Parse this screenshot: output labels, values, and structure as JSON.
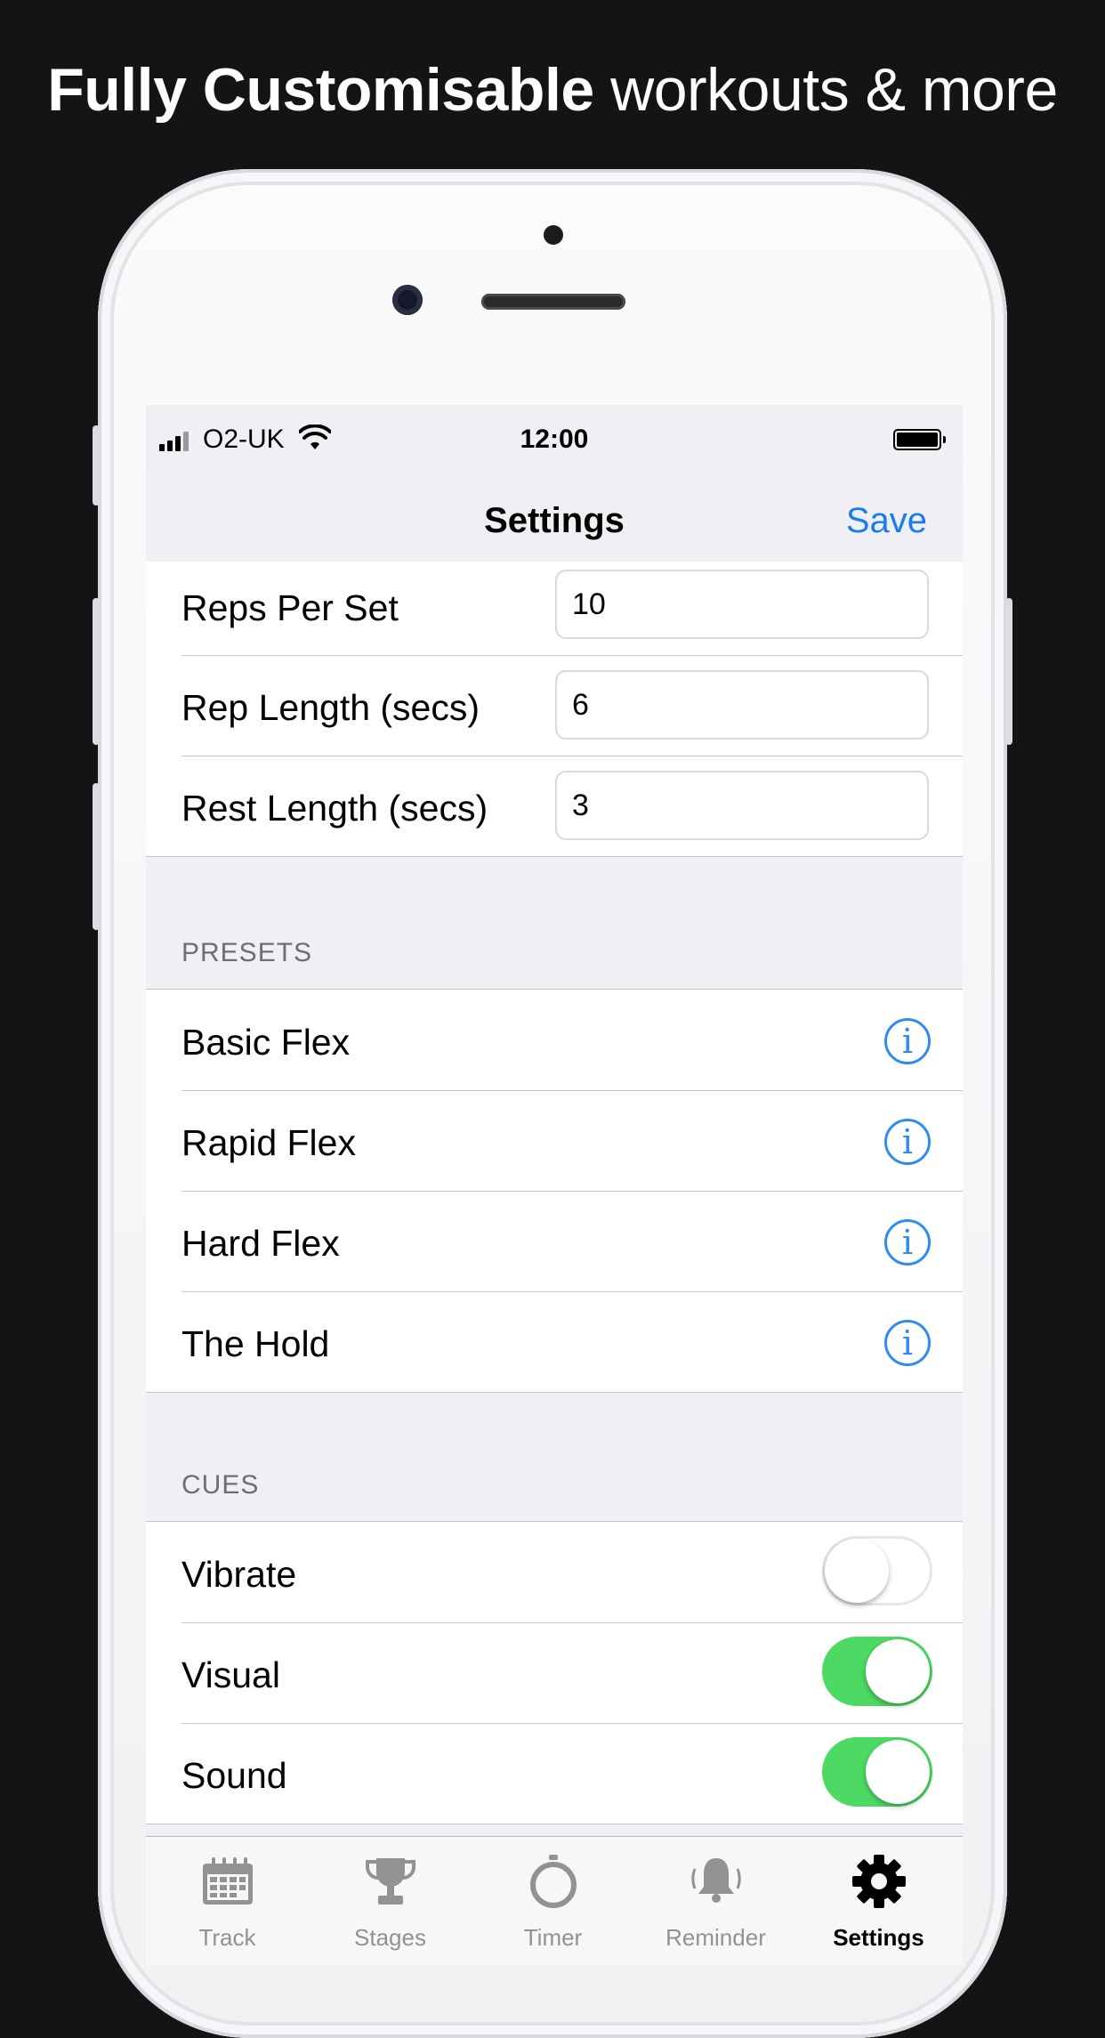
{
  "headline": {
    "bold": "Fully Customisable",
    "light": "workouts & more"
  },
  "status_bar": {
    "carrier": "O2-UK",
    "time": "12:00"
  },
  "nav": {
    "title": "Settings",
    "save": "Save"
  },
  "workout": [
    {
      "label": "Reps Per Set",
      "value": "10"
    },
    {
      "label": "Rep Length (secs)",
      "value": "6"
    },
    {
      "label": "Rest Length (secs)",
      "value": "3"
    }
  ],
  "presets": {
    "header": "PRESETS",
    "items": [
      "Basic Flex",
      "Rapid Flex",
      "Hard Flex",
      "The Hold"
    ],
    "info_icon": "info-icon",
    "info_glyph": "i"
  },
  "cues": {
    "header": "CUES",
    "items": [
      {
        "label": "Vibrate",
        "on": false
      },
      {
        "label": "Visual",
        "on": true
      },
      {
        "label": "Sound",
        "on": true
      }
    ]
  },
  "tabs": [
    {
      "label": "Track",
      "icon": "calendar-icon",
      "active": false
    },
    {
      "label": "Stages",
      "icon": "trophy-icon",
      "active": false
    },
    {
      "label": "Timer",
      "icon": "stopwatch-icon",
      "active": false
    },
    {
      "label": "Reminder",
      "icon": "bell-icon",
      "active": false
    },
    {
      "label": "Settings",
      "icon": "gear-icon",
      "active": true
    }
  ],
  "colors": {
    "accent": "#1a7cf0",
    "toggle_on": "#4cd964",
    "background": "#141416"
  }
}
